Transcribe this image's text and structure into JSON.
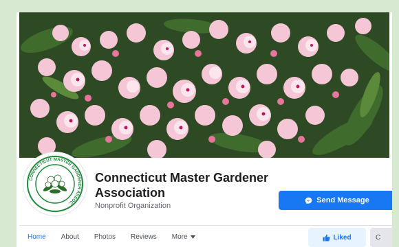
{
  "page": {
    "title": "Connecticut Master Gardener Association",
    "category": "Nonprofit Organization"
  },
  "profile_logo": {
    "ring_text": "CONNECTICUT MASTER GARDENER ASSOC."
  },
  "actions": {
    "send_message_label": "Send Message",
    "liked_label": "Liked",
    "more_label": "C"
  },
  "tabs": [
    {
      "label": "Home",
      "active": true
    },
    {
      "label": "About",
      "active": false
    },
    {
      "label": "Photos",
      "active": false
    },
    {
      "label": "Reviews",
      "active": false
    },
    {
      "label": "More",
      "active": false
    }
  ],
  "icons": {
    "messenger": "messenger-icon",
    "like": "thumbs-up-icon",
    "more_caret": "caret-down-icon"
  },
  "colors": {
    "brand_blue": "#1877f2",
    "liked_bg": "#e7f3ff",
    "logo_green": "#1e8a3a",
    "background": "#d7e9d0"
  }
}
